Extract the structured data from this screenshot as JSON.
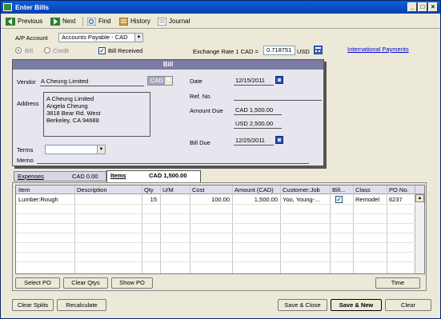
{
  "window": {
    "title": "Enter Bills"
  },
  "toolbar": {
    "previous": "Previous",
    "next": "Next",
    "find": "Find",
    "history": "History",
    "journal": "Journal"
  },
  "header": {
    "ap_account_label": "A/P Account",
    "ap_account_value": "Accounts Payable - CAD",
    "bill_radio": "Bill",
    "credit_radio": "Credit",
    "bill_received": "Bill Received",
    "exchange_rate_label": "Exchange Rate 1 CAD =",
    "exchange_rate_value": "0.718751",
    "exchange_currency": "USD",
    "international_payments": "International Payments"
  },
  "bill": {
    "title": "Bill",
    "vendor_label": "Vendor",
    "vendor_value": "A Cheung Limited",
    "vendor_currency": "CAD",
    "date_label": "Date",
    "date_value": "12/15/2011",
    "refno_label": "Ref. No.",
    "address_label": "Address",
    "address_lines": [
      "A Cheung Limited",
      "Angela Cheung",
      "3818 Bear Rd. West",
      "Berkeley, CA 94688"
    ],
    "amount_due_label": "Amount Due",
    "amount_due_cad": "CAD  1,500.00",
    "amount_due_usd": "USD  2,500.00",
    "terms_label": "Terms",
    "bill_due_label": "Bill Due",
    "bill_due_value": "12/25/2011",
    "memo_label": "Memo"
  },
  "tabs": {
    "expenses_label": "Expenses",
    "expenses_amount": "CAD  0.00",
    "items_label": "Items",
    "items_amount": "CAD  1,500.00"
  },
  "grid": {
    "columns": [
      "Item",
      "Description",
      "Qty",
      "U/M",
      "Cost",
      "Amount (CAD)",
      "Customer:Job",
      "Bill...",
      "Class",
      "PO No."
    ],
    "row": {
      "item": "Lumber:Rough",
      "description": "",
      "qty": "15",
      "um": "",
      "cost": "100.00",
      "amount": "1,500.00",
      "customer": "Yoo, Young-...",
      "billable": "✓",
      "class": "Remodel",
      "po": "6237"
    }
  },
  "grid_buttons": {
    "select_po": "Select PO",
    "clear_qtys": "Clear Qtys",
    "show_po": "Show PO",
    "time": "Time"
  },
  "footer": {
    "clear_splits": "Clear Splits",
    "recalculate": "Recalculate",
    "save_close": "Save & Close",
    "save_new": "Save & New",
    "clear": "Clear"
  }
}
